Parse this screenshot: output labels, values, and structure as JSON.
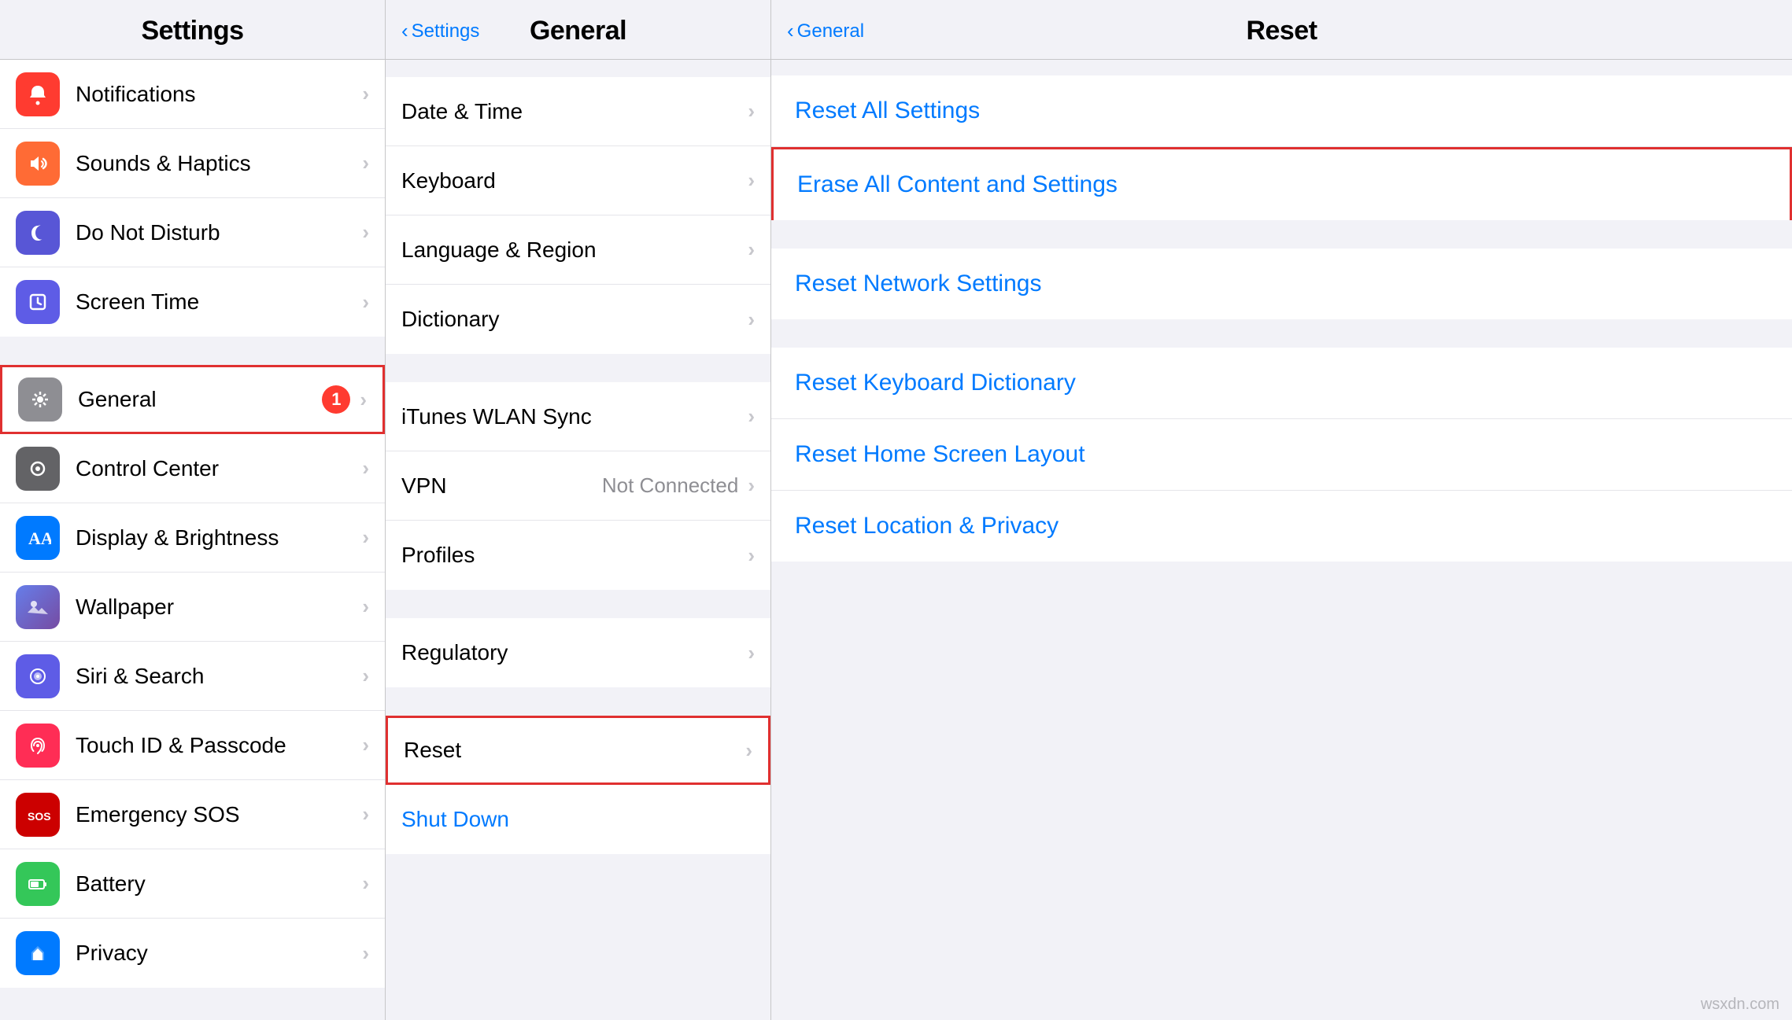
{
  "columns": {
    "left": {
      "title": "Settings",
      "items": [
        {
          "id": "notifications",
          "label": "Notifications",
          "icon": "🔔",
          "iconBg": "icon-red",
          "badge": null,
          "highlighted": false
        },
        {
          "id": "sounds",
          "label": "Sounds & Haptics",
          "icon": "🔊",
          "iconBg": "icon-orange-red",
          "badge": null,
          "highlighted": false
        },
        {
          "id": "donotdisturb",
          "label": "Do Not Disturb",
          "icon": "🌙",
          "iconBg": "icon-purple",
          "badge": null,
          "highlighted": false
        },
        {
          "id": "screentime",
          "label": "Screen Time",
          "icon": "⏳",
          "iconBg": "icon-blue",
          "badge": null,
          "highlighted": false
        },
        {
          "id": "general",
          "label": "General",
          "icon": "⚙️",
          "iconBg": "icon-gray",
          "badge": "1",
          "highlighted": true
        },
        {
          "id": "controlcenter",
          "label": "Control Center",
          "icon": "◉",
          "iconBg": "icon-dark",
          "badge": null,
          "highlighted": false
        },
        {
          "id": "displaybrightness",
          "label": "Display & Brightness",
          "icon": "AA",
          "iconBg": "icon-blue",
          "badge": null,
          "highlighted": false
        },
        {
          "id": "wallpaper",
          "label": "Wallpaper",
          "icon": "🌸",
          "iconBg": "icon-wallpaper",
          "badge": null,
          "highlighted": false
        },
        {
          "id": "sirisearch",
          "label": "Siri & Search",
          "icon": "◎",
          "iconBg": "icon-indigo",
          "badge": null,
          "highlighted": false
        },
        {
          "id": "touchid",
          "label": "Touch ID & Passcode",
          "icon": "👆",
          "iconBg": "icon-pink",
          "badge": null,
          "highlighted": false
        },
        {
          "id": "emergencysos",
          "label": "Emergency SOS",
          "icon": "SOS",
          "iconBg": "icon-sos",
          "badge": null,
          "highlighted": false
        },
        {
          "id": "battery",
          "label": "Battery",
          "icon": "🔋",
          "iconBg": "icon-green",
          "badge": null,
          "highlighted": false
        },
        {
          "id": "privacy",
          "label": "Privacy",
          "icon": "✋",
          "iconBg": "icon-blue",
          "badge": null,
          "highlighted": false
        }
      ]
    },
    "middle": {
      "title": "General",
      "back_label": "Settings",
      "sections": [
        {
          "items": [
            {
              "id": "datetime",
              "label": "Date & Time",
              "value": "",
              "highlighted": false
            },
            {
              "id": "keyboard",
              "label": "Keyboard",
              "value": "",
              "highlighted": false
            },
            {
              "id": "language",
              "label": "Language & Region",
              "value": "",
              "highlighted": false
            },
            {
              "id": "dictionary",
              "label": "Dictionary",
              "value": "",
              "highlighted": false
            }
          ]
        },
        {
          "items": [
            {
              "id": "ituneswlan",
              "label": "iTunes WLAN Sync",
              "value": "",
              "highlighted": false
            },
            {
              "id": "vpn",
              "label": "VPN",
              "value": "Not Connected",
              "highlighted": false
            },
            {
              "id": "profiles",
              "label": "Profiles",
              "value": "",
              "highlighted": false
            }
          ]
        },
        {
          "items": [
            {
              "id": "regulatory",
              "label": "Regulatory",
              "value": "",
              "highlighted": false
            }
          ]
        },
        {
          "items": [
            {
              "id": "reset",
              "label": "Reset",
              "value": "",
              "highlighted": true
            },
            {
              "id": "shutdown",
              "label": "Shut Down",
              "value": "",
              "highlighted": false,
              "isLink": true
            }
          ]
        }
      ]
    },
    "right": {
      "title": "Reset",
      "back_label": "General",
      "sections": [
        {
          "items": [
            {
              "id": "resetall",
              "label": "Reset All Settings",
              "highlighted": false
            },
            {
              "id": "eraseall",
              "label": "Erase All Content and Settings",
              "highlighted": true
            }
          ]
        },
        {
          "items": [
            {
              "id": "resetnetwork",
              "label": "Reset Network Settings",
              "highlighted": false
            }
          ]
        },
        {
          "items": [
            {
              "id": "resetkeyboard",
              "label": "Reset Keyboard Dictionary",
              "highlighted": false
            },
            {
              "id": "resethome",
              "label": "Reset Home Screen Layout",
              "highlighted": false
            },
            {
              "id": "resetlocation",
              "label": "Reset Location & Privacy",
              "highlighted": false
            }
          ]
        }
      ]
    }
  },
  "watermark": "wsxdn.com"
}
